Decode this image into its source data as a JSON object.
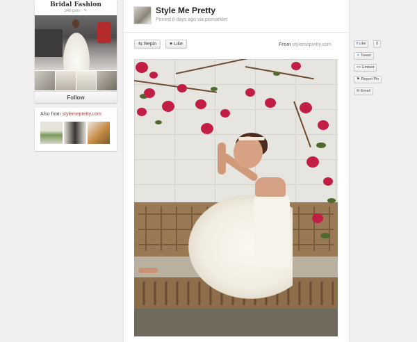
{
  "board": {
    "title": "Bridal Fashion",
    "pins": "346 pins ·",
    "follow": "Follow"
  },
  "also_from": {
    "prefix": "Also from",
    "site": "stylemepretty.com"
  },
  "pin": {
    "title": "Style Me Pretty",
    "meta": "Pinned 8 days ago via pinmarklet",
    "repin_label": "Repin",
    "like_label": "Like",
    "from_label": "From",
    "from_site": "stylemepretty.com"
  },
  "share": {
    "fb_like": "Like",
    "fb_count": "0",
    "tweet": "Tweet",
    "embed": "Embed",
    "report": "Report Pin",
    "email": "Email"
  },
  "colors": {
    "background": "#f1efef",
    "link": "#a8473d",
    "flowers": "#c21d45"
  },
  "icons": {
    "repin": "repin-icon",
    "like": "heart-icon",
    "fb": "facebook-icon",
    "twitter": "twitter-icon",
    "embed": "code-icon",
    "report": "flag-icon",
    "email": "email-icon"
  }
}
